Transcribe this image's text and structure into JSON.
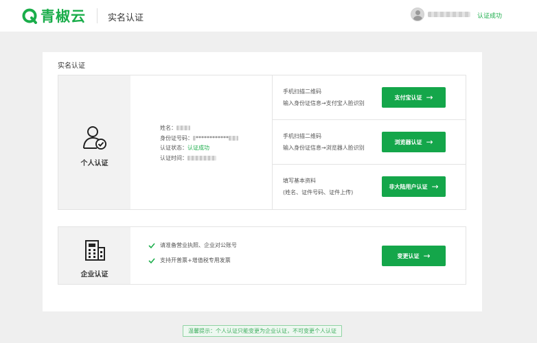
{
  "header": {
    "logo_text": "青椒云",
    "page_title": "实名认证",
    "user_status": "认证成功",
    "brand_color": "#1aad4a"
  },
  "panel": {
    "title": "实名认证"
  },
  "personal": {
    "label": "个人认证",
    "icon": "user-verified-icon",
    "info": {
      "name_label": "姓名：",
      "id_label": "身份证号码：",
      "id_value": "************",
      "status_label": "认证状态：",
      "status_value": "认证成功",
      "time_label": "认证时间："
    },
    "options": [
      {
        "line1": "手机扫描二维码",
        "line2": "输入身份证信息→支付宝人脸识别",
        "button": "支付宝认证"
      },
      {
        "line1": "手机扫描二维码",
        "line2": "输入身份证信息→浏览器人脸识别",
        "button": "浏览器认证"
      },
      {
        "line1": "填写基本资料",
        "line2": "(姓名、证件号码、证件上传)",
        "button": "非大陆用户认证"
      }
    ]
  },
  "enterprise": {
    "label": "企业认证",
    "icon": "building-icon",
    "items": [
      "请准备营业执照、企业对公账号",
      "支持开普票+增值税专用发票"
    ],
    "button": "变更认证"
  },
  "tip": {
    "text": "温馨提示：个人认证只能变更为企业认证，不可变更个人认证"
  }
}
